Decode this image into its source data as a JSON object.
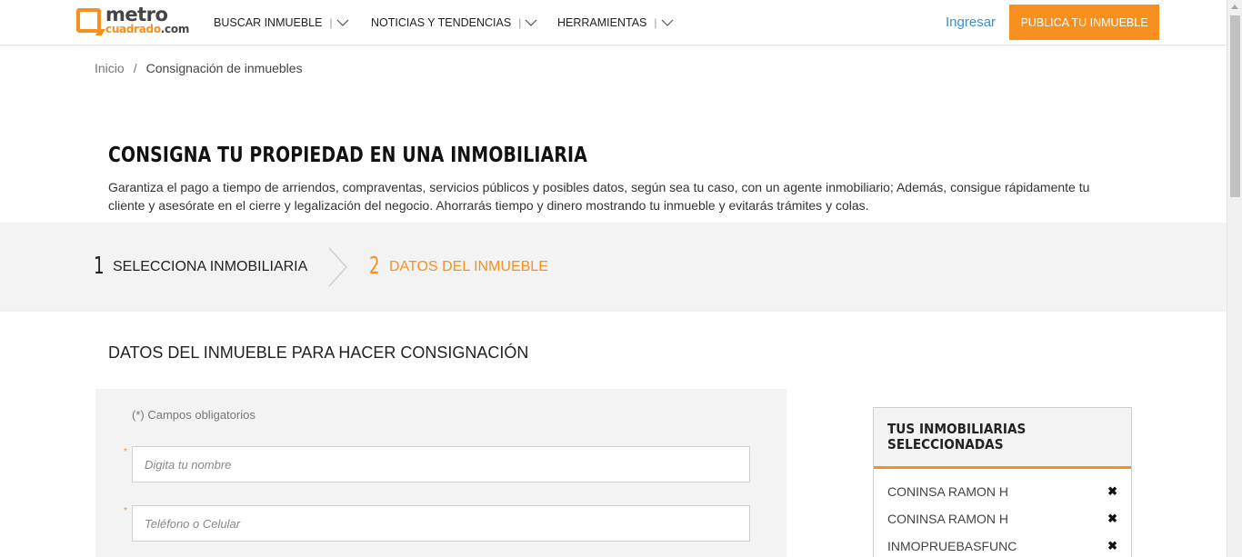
{
  "header": {
    "logo": {
      "line1": "metro",
      "line2": "cuadrado",
      "suffix": ".com"
    },
    "nav": [
      {
        "label": "BUSCAR INMUEBLE",
        "separator": "|"
      },
      {
        "label": "NOTICIAS Y TENDENCIAS",
        "separator": "|"
      },
      {
        "label": "HERRAMIENTAS",
        "separator": "|"
      }
    ],
    "login_label": "Ingresar",
    "publish_label": "PUBLICA TU INMUEBLE"
  },
  "breadcrumb": {
    "home": "Inicio",
    "separator": "/",
    "current": "Consignación de inmuebles"
  },
  "intro": {
    "title": "CONSIGNA TU PROPIEDAD EN UNA INMOBILIARIA",
    "text": "Garantiza el pago a tiempo de arriendos, compraventas, servicios públicos y posibles datos, según sea tu caso, con un agente inmobiliario; Además, consigue rápidamente tu cliente y asesórate en el cierre y legalización del negocio. Ahorrarás tiempo y dinero mostrando tu inmueble y evitarás trámites y colas."
  },
  "steps": [
    {
      "number": "1",
      "label": "SELECCIONA INMOBILIARIA",
      "active": false
    },
    {
      "number": "2",
      "label": "DATOS DEL INMUEBLE",
      "active": true
    }
  ],
  "form": {
    "title": "DATOS DEL INMUEBLE PARA HACER CONSIGNACIÓN",
    "required_note": "(*) Campos obligatorios",
    "required_mark": "*",
    "fields": [
      {
        "placeholder": "Digita tu nombre",
        "value": ""
      },
      {
        "placeholder": "Teléfono o Celular",
        "value": ""
      }
    ]
  },
  "selected": {
    "title": "TUS INMOBILIARIAS SELECCIONADAS",
    "remove_symbol": "✖",
    "items": [
      "CONINSA RAMON H",
      "CONINSA RAMON H",
      "INMOPRUEBASFUNC"
    ]
  },
  "colors": {
    "accent": "#f7901e",
    "link": "#3b8fd2",
    "band": "#f3f3f3"
  },
  "icons": [
    "chevron-down-icon",
    "step-arrow-icon",
    "remove-icon"
  ]
}
